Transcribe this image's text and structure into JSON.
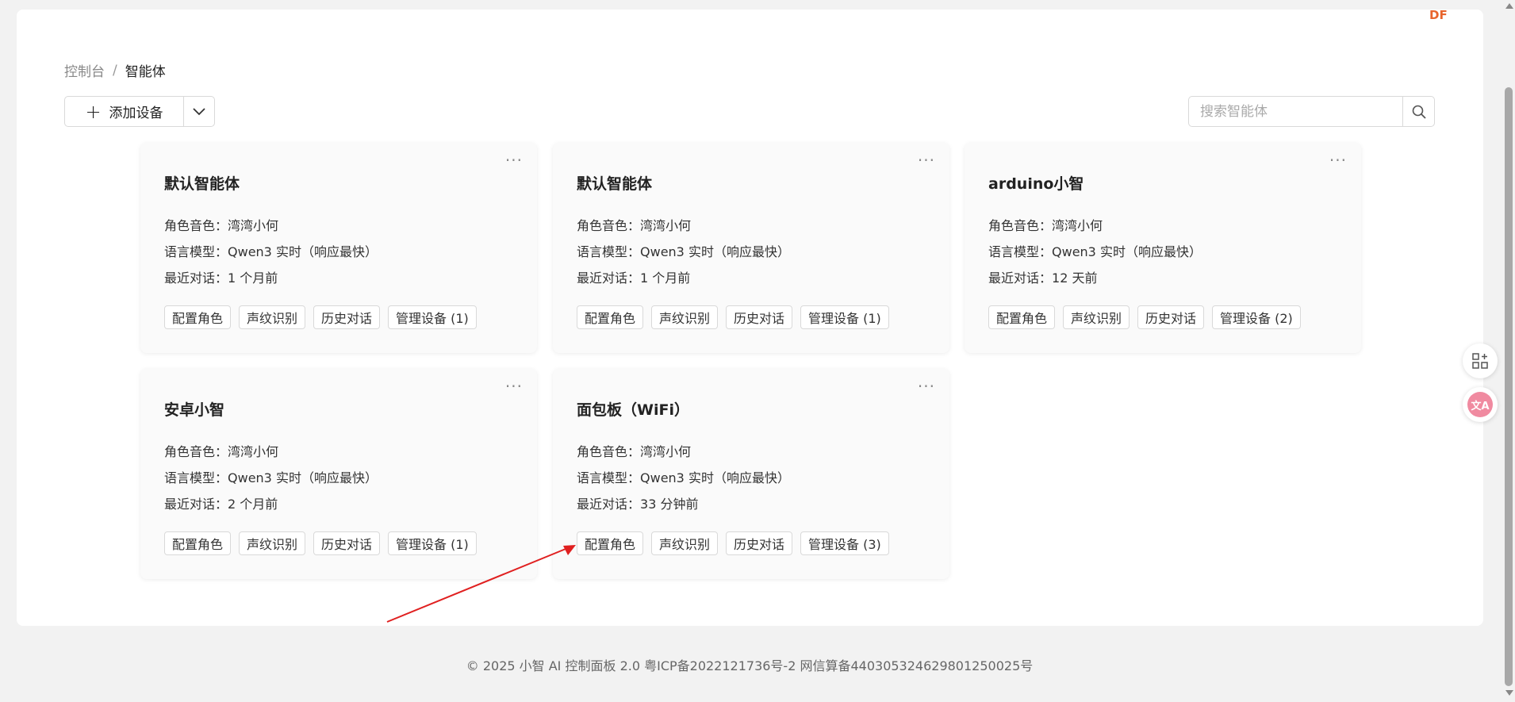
{
  "breadcrumb": {
    "root": "控制台",
    "separator": "/",
    "current": "智能体"
  },
  "toolbar": {
    "add_label": "添加设备",
    "search_placeholder": "搜索智能体"
  },
  "logo": {
    "text": "DF"
  },
  "labels": {
    "voice": "角色音色：",
    "model": "语言模型：",
    "recent": "最近对话："
  },
  "agents": [
    {
      "name": "默认智能体",
      "voice": "湾湾小何",
      "model": "Qwen3 实时（响应最快）",
      "recent": "1 个月前",
      "actions": [
        "配置角色",
        "声纹识别",
        "历史对话",
        "管理设备 (1)"
      ]
    },
    {
      "name": "默认智能体",
      "voice": "湾湾小何",
      "model": "Qwen3 实时（响应最快）",
      "recent": "1 个月前",
      "actions": [
        "配置角色",
        "声纹识别",
        "历史对话",
        "管理设备 (1)"
      ]
    },
    {
      "name": "arduino小智",
      "voice": "湾湾小何",
      "model": "Qwen3 实时（响应最快）",
      "recent": "12 天前",
      "actions": [
        "配置角色",
        "声纹识别",
        "历史对话",
        "管理设备 (2)"
      ]
    },
    {
      "name": "安卓小智",
      "voice": "湾湾小何",
      "model": "Qwen3 实时（响应最快）",
      "recent": "2 个月前",
      "actions": [
        "配置角色",
        "声纹识别",
        "历史对话",
        "管理设备 (1)"
      ]
    },
    {
      "name": "面包板（WiFi）",
      "voice": "湾湾小何",
      "model": "Qwen3 实时（响应最快）",
      "recent": "33 分钟前",
      "actions": [
        "配置角色",
        "声纹识别",
        "历史对话",
        "管理设备 (3)"
      ]
    }
  ],
  "footer": {
    "text": "© 2025 小智 AI 控制面板 2.0 粤ICP备2022121736号-2 网信算备440305324629801250025号"
  },
  "colors": {
    "accent": "#e8642c",
    "annotation": "#e02020"
  }
}
